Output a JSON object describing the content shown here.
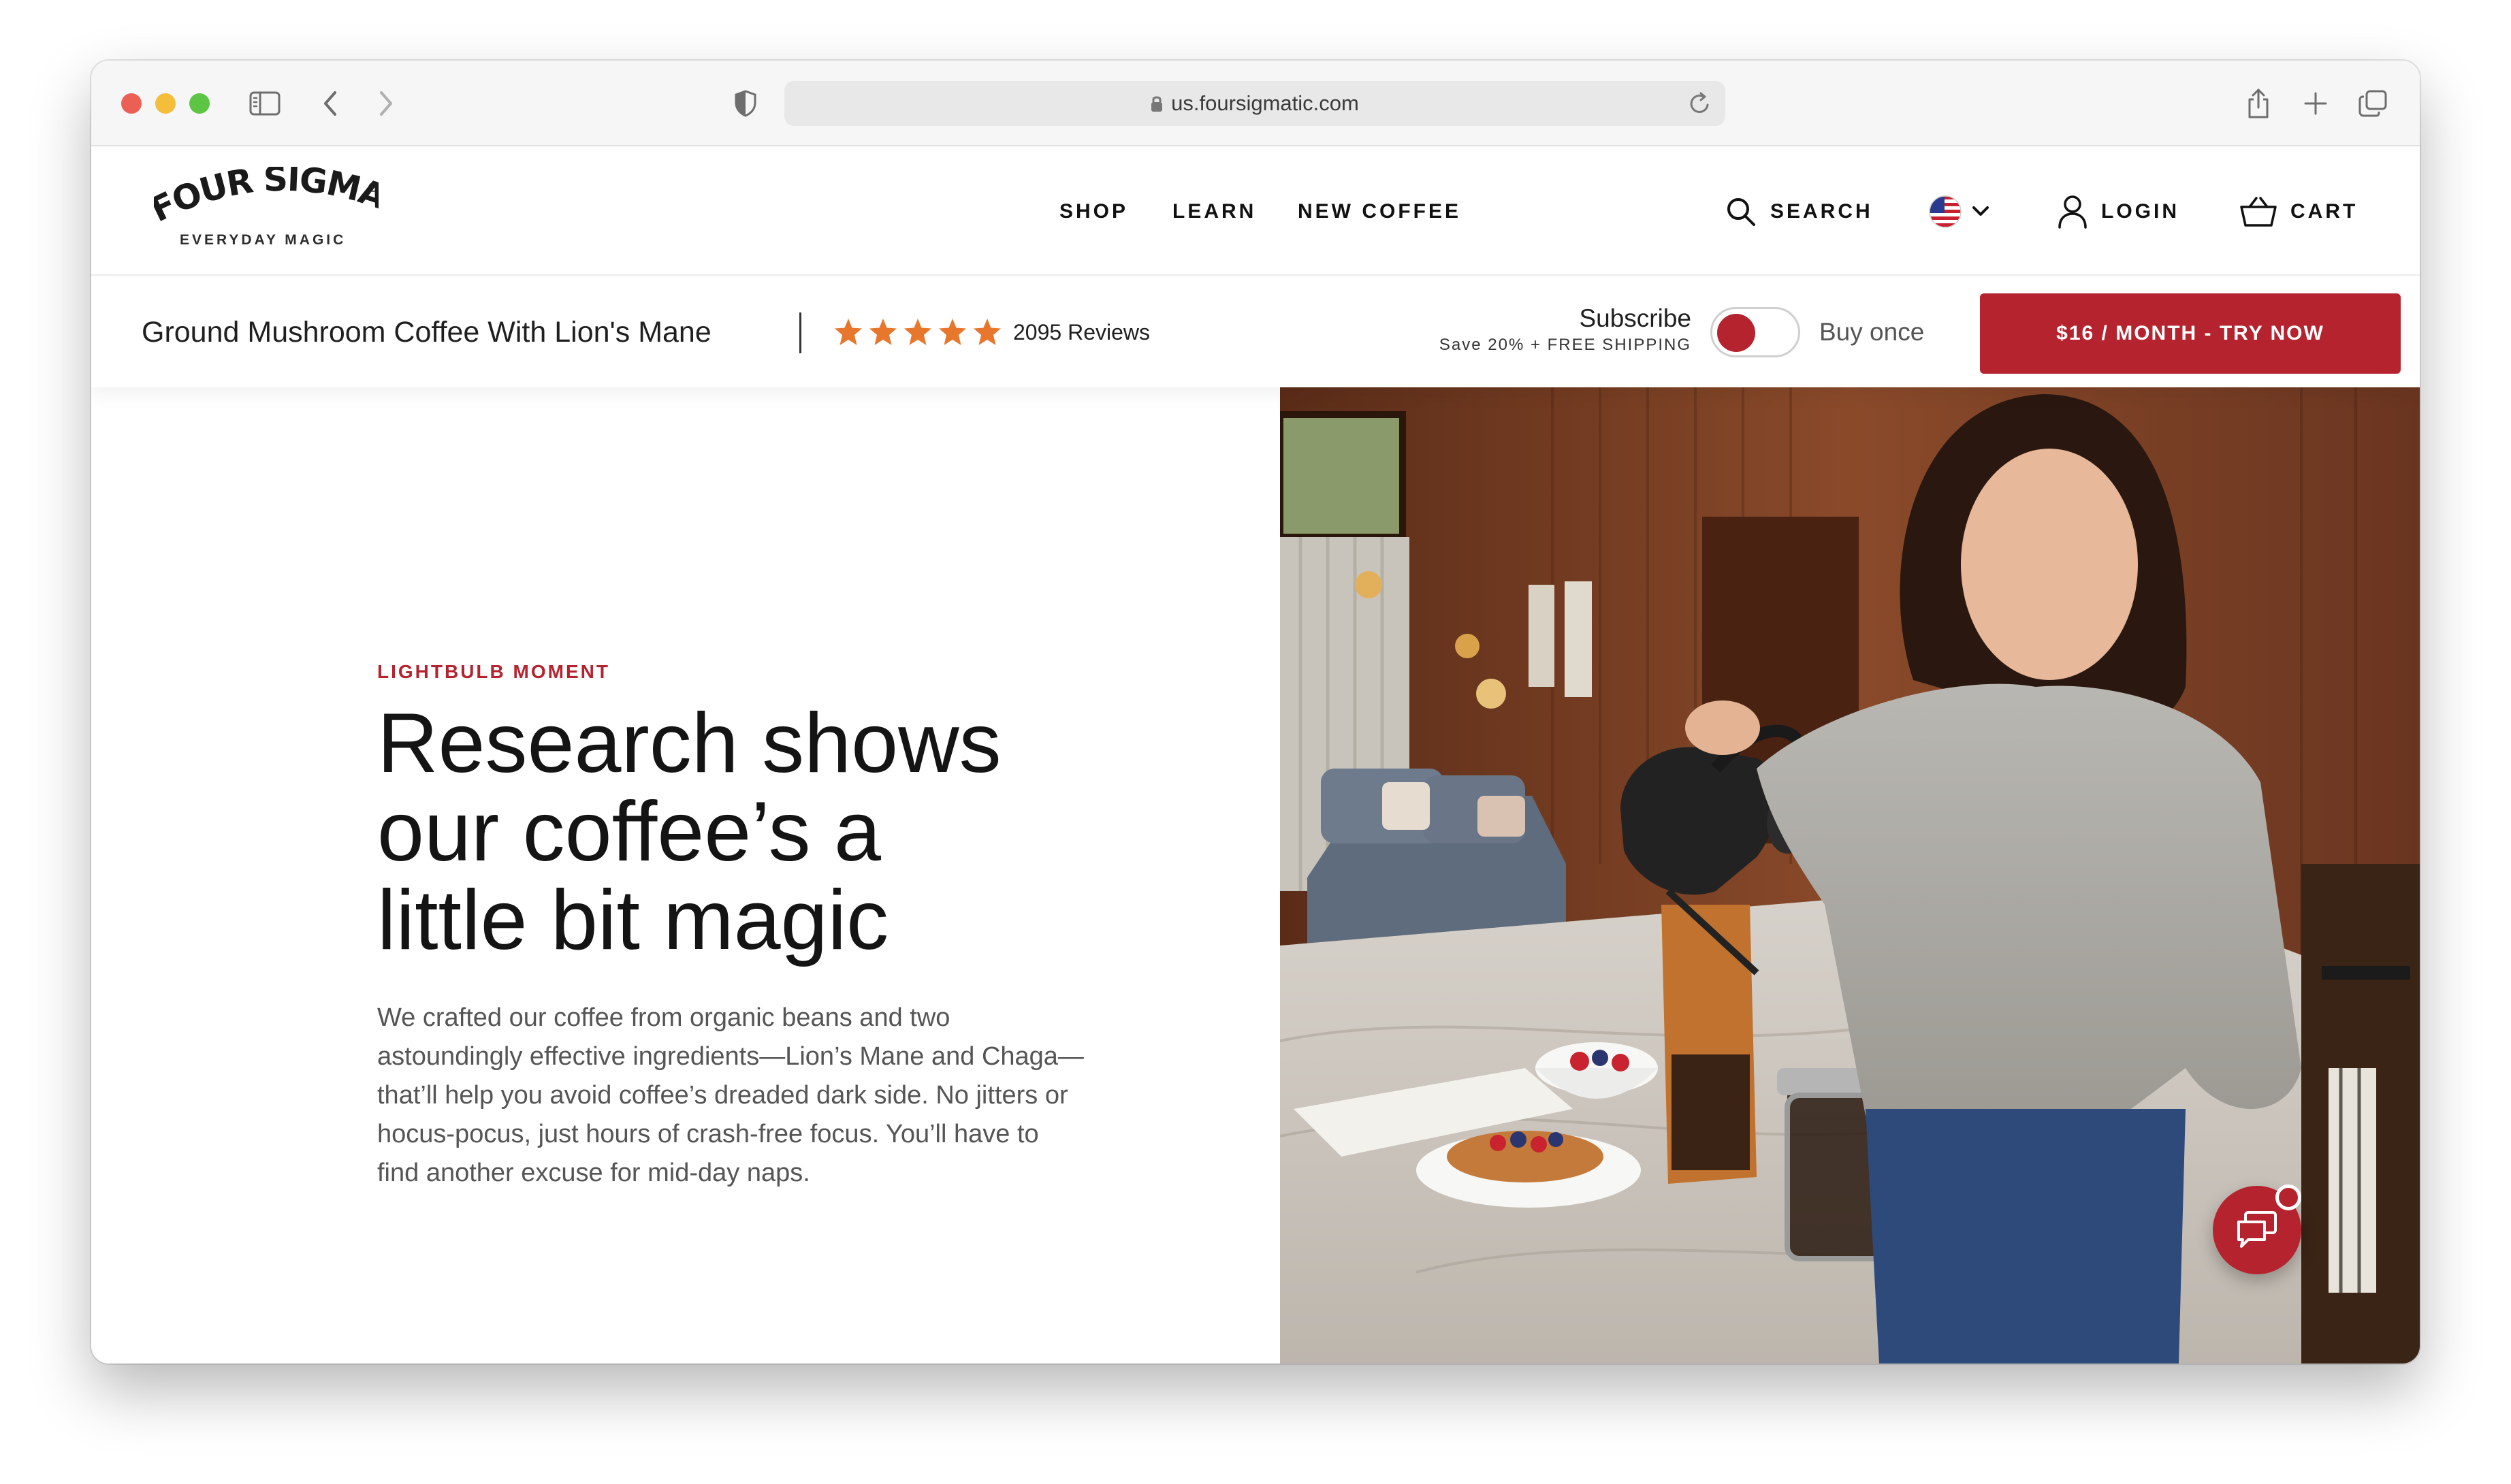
{
  "browser": {
    "url": "us.foursigmatic.com"
  },
  "header": {
    "logo_text": "FOUR SIGMATIC",
    "logo_tagline": "EVERYDAY MAGIC",
    "nav": {
      "shop": "SHOP",
      "learn": "LEARN",
      "new_coffee": "NEW COFFEE"
    },
    "search": "SEARCH",
    "login": "LOGIN",
    "cart": "CART"
  },
  "product_bar": {
    "title": "Ground Mushroom Coffee With Lion's Mane",
    "rating": 5,
    "reviews": "2095 Reviews",
    "subscribe_label": "Subscribe",
    "subscribe_note": "Save 20% + FREE SHIPPING",
    "buy_once": "Buy once",
    "cta": "$16 / MONTH - TRY NOW"
  },
  "hero": {
    "eyebrow": "LIGHTBULB MOMENT",
    "headline_1": "Research shows",
    "headline_2": "our coffee’s a",
    "headline_3": "little bit magic",
    "body": "We crafted our coffee from organic beans and two astoundingly effective ingredients—Lion’s Mane and Chaga—that’ll help you avoid coffee’s dreaded dark side. No jitters or hocus-pocus, just hours of crash-free focus. You’ll have to find another excuse for mid-day naps."
  },
  "colors": {
    "brand_red": "#b5232f",
    "star_orange": "#e8772e"
  }
}
